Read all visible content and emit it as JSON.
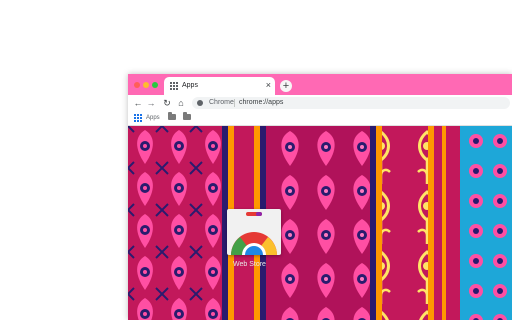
{
  "tab": {
    "title": "Apps",
    "close_glyph": "×"
  },
  "newtab": {
    "glyph": "+"
  },
  "toolbar": {
    "back": "←",
    "forward": "→",
    "reload": "↻",
    "home": "⌂"
  },
  "omnibox": {
    "chip": "Chrome",
    "url": "chrome://apps"
  },
  "bookmarks": {
    "apps_label": "Apps"
  },
  "apps": [
    {
      "name": "Web Store"
    }
  ],
  "colors": {
    "frame": "#ff69b4",
    "wallpaper_magenta": "#c2185b",
    "pattern_pink": "#ff4fa3",
    "pattern_navy": "#2a1b6e",
    "stripe_orange": "#ff9800",
    "stripe_yellow": "#ffe566",
    "stripe_cyan": "#1ea7d8"
  },
  "icons": [
    "apps-grid-icon",
    "close-icon",
    "plus-icon",
    "back-arrow-icon",
    "forward-arrow-icon",
    "reload-icon",
    "home-icon",
    "site-info-icon",
    "folder-icon",
    "chrome-web-store-icon"
  ]
}
